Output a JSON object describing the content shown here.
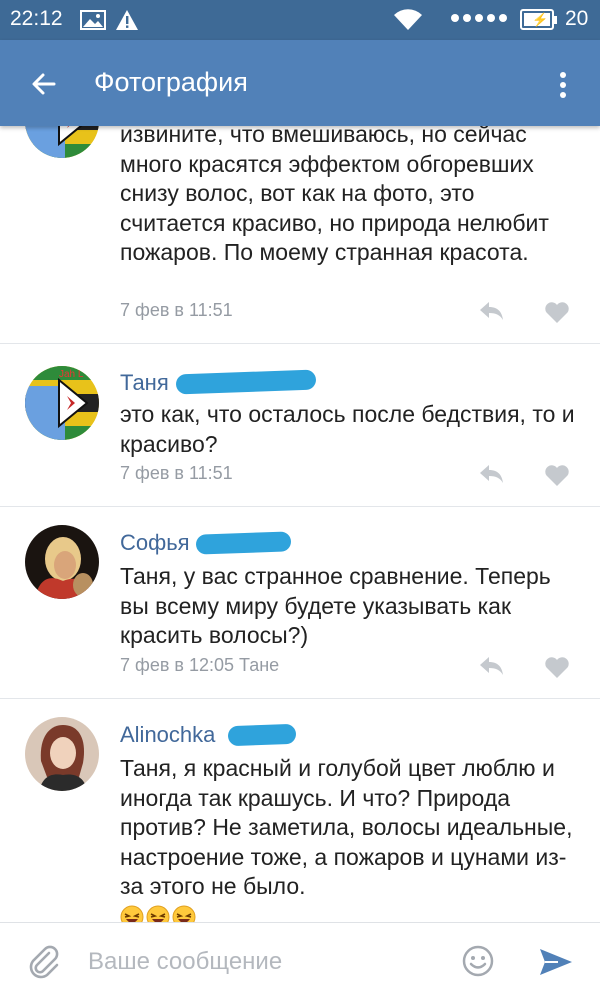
{
  "status_bar": {
    "time": "22:12",
    "battery_level": "20"
  },
  "app_bar": {
    "title": "Фотография"
  },
  "comments": [
    {
      "author": "",
      "text": "извините, что вмешиваюсь, но сейчас много красятся эффектом обгоревших снизу волос, вот как на фото, это считается красиво, но природа нелюбит пожаров. По моему странная красота.",
      "meta": "7 фев в 11:51"
    },
    {
      "author": "Таня",
      "avatar_label": "Jah L",
      "text": "это как, что осталось после бедствия, то и красиво?",
      "meta": "7 фев в 11:51"
    },
    {
      "author": "Софья",
      "text": "Таня, у вас странное сравнение. Теперь вы всему миру будете указывать как красить волосы?)",
      "meta": "7 фев в 12:05 Тане"
    },
    {
      "author": "Alinochka",
      "text": "Таня, я красный и голубой цвет люблю и иногда так крашусь. И что? Природа против? Не заметила, волосы идеальные, настроение тоже, а пожаров и цунами из-за этого не было."
    }
  ],
  "input_bar": {
    "placeholder": "Ваше сообщение"
  },
  "colors": {
    "status_bar": "#3e6a96",
    "app_bar": "#5181b8",
    "author": "#41689a",
    "meta": "#959ba3",
    "send": "#5181b8"
  },
  "icons": [
    "image-icon",
    "warning-icon",
    "wifi-icon",
    "signal-icon",
    "battery-icon",
    "back-arrow-icon",
    "more-vert-icon",
    "reply-icon",
    "heart-icon",
    "laughing-emoji-icon",
    "paperclip-icon",
    "smile-icon",
    "send-icon"
  ]
}
